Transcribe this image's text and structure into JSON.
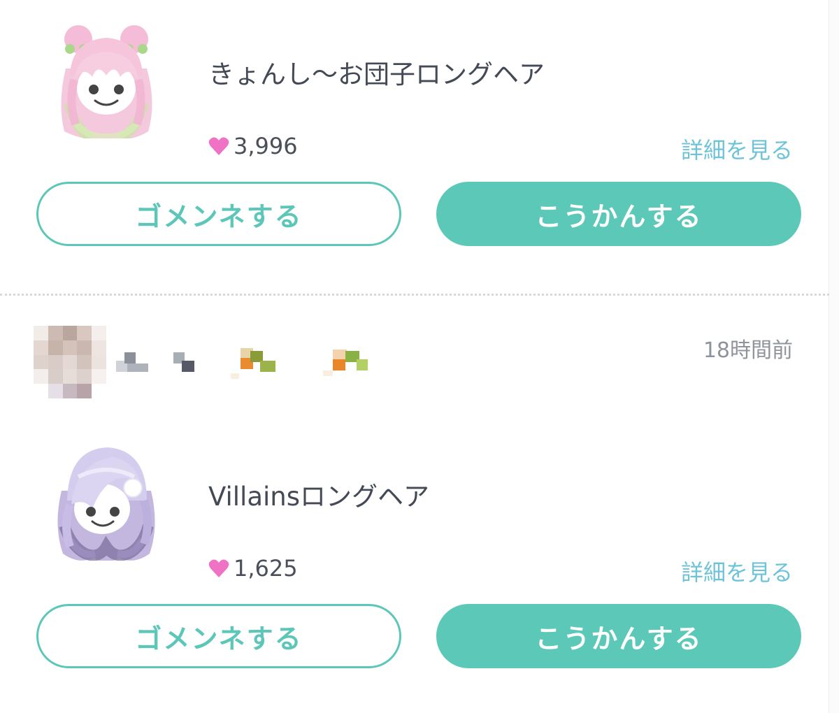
{
  "items": [
    {
      "title": "きょんし〜お団子ロングヘア",
      "likes": "3,996",
      "detail_label": "詳細を見る",
      "decline_label": "ゴメンネする",
      "exchange_label": "こうかんする",
      "thumbnail_icon": "pink-long-hair-avatar-icon"
    },
    {
      "title": "Villainsロングヘア",
      "likes": "1,625",
      "detail_label": "詳細を見る",
      "decline_label": "ゴメンネする",
      "exchange_label": "こうかんする",
      "thumbnail_icon": "lavender-long-hair-avatar-icon"
    }
  ],
  "request": {
    "timestamp": "18時間前"
  },
  "colors": {
    "accent": "#5cc8b8",
    "link": "#6ec3d8",
    "heart": "#ef72c5",
    "text": "#434a55",
    "muted": "#8f949c"
  }
}
